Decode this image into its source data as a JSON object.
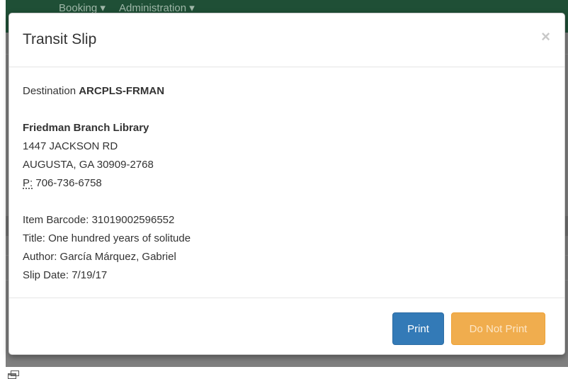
{
  "navbar": {
    "items": [
      {
        "label": "Booking ▾"
      },
      {
        "label": "Administration ▾"
      }
    ]
  },
  "modal": {
    "title": "Transit Slip",
    "close_label": "×",
    "destination": {
      "label": "Destination",
      "code": "ARCPLS-FRMAN"
    },
    "branch": {
      "name": "Friedman Branch Library",
      "street": "1447 JACKSON RD",
      "city_state_zip": "AUGUSTA, GA 30909-2768",
      "phone_abbr": "P:",
      "phone": "706-736-6758"
    },
    "item": {
      "barcode_label": "Item Barcode:",
      "barcode": "31019002596552",
      "title_label": "Title:",
      "title": "One hundred years of solitude",
      "author_label": "Author:",
      "author": "García Márquez, Gabriel",
      "slip_date_label": "Slip Date:",
      "slip_date": "7/19/17"
    },
    "buttons": {
      "print": "Print",
      "do_not_print": "Do Not Print"
    }
  },
  "colors": {
    "navbar": "#1f4f36",
    "primary": "#337ab7",
    "warning": "#f0ad4e",
    "backdrop": "#7f7f7f"
  },
  "icons": {
    "close": "close-icon",
    "resize": "resize-window-icon"
  }
}
